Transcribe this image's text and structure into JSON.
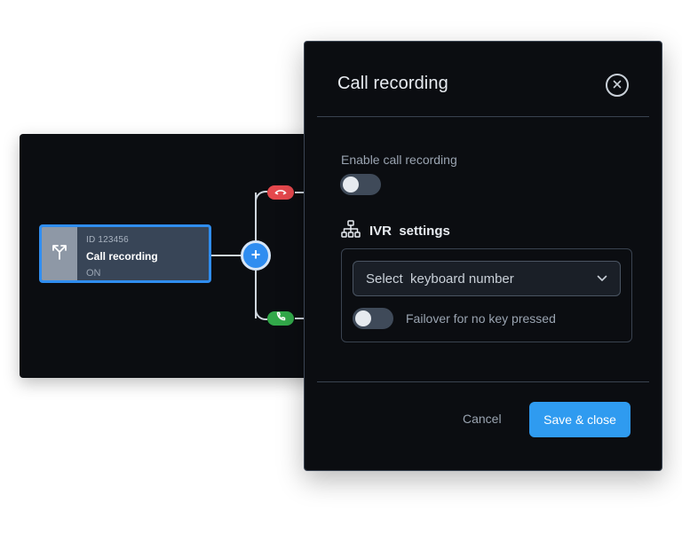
{
  "flow": {
    "node": {
      "id_label": "ID 123456",
      "title": "Call recording",
      "status": "ON",
      "icon": "split-arrows-icon"
    },
    "add_button": {
      "label": "+"
    },
    "branches": [
      {
        "icon": "phone-hangup-icon",
        "color": "#e5484d"
      },
      {
        "icon": "phone-answer-icon",
        "color": "#32a94a"
      }
    ]
  },
  "modal": {
    "title": "Call recording",
    "close_icon": "close-circle-icon",
    "enable_recording": {
      "label": "Enable call recording",
      "checked": false
    },
    "ivr": {
      "icon": "hierarchy-icon",
      "heading": "IVR  settings",
      "select": {
        "value": "Select  keyboard number",
        "icon": "chevron-down-icon"
      },
      "failover": {
        "label": "Failover for no key pressed",
        "checked": false
      }
    },
    "footer": {
      "cancel_label": "Cancel",
      "save_label": "Save & close"
    }
  },
  "colors": {
    "accent": "#2f8df0",
    "modal_bg": "#0b0d11",
    "hangup": "#e5484d",
    "answer": "#32a94a"
  }
}
